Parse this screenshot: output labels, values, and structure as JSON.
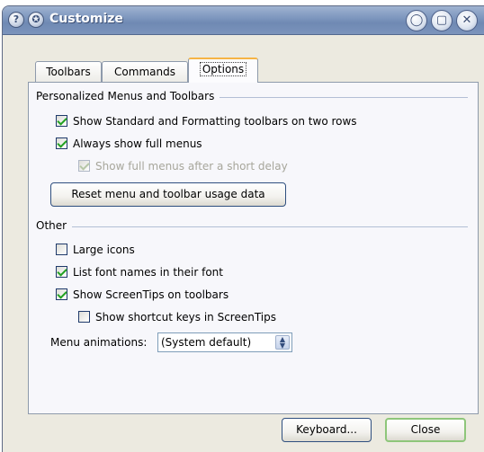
{
  "window": {
    "title": "Customize",
    "help_icon": "?",
    "app_icon": "✪",
    "minimize_symbol": "◯",
    "restore_symbol": "▢",
    "close_symbol": "✕"
  },
  "tabs": [
    {
      "label": "Toolbars",
      "active": false
    },
    {
      "label": "Commands",
      "active": false
    },
    {
      "label": "Options",
      "active": true
    }
  ],
  "personalized": {
    "group_title": "Personalized Menus and Toolbars",
    "two_rows": {
      "label": "Show Standard and Formatting toolbars on two rows",
      "checked": true,
      "enabled": true
    },
    "full_menus": {
      "label": "Always show full menus",
      "checked": true,
      "enabled": true
    },
    "delay": {
      "label": "Show full menus after a short delay",
      "checked": true,
      "enabled": false
    },
    "reset_button": "Reset menu and toolbar usage data"
  },
  "other": {
    "group_title": "Other",
    "large_icons": {
      "label": "Large icons",
      "checked": false
    },
    "font_names": {
      "label": "List font names in their font",
      "checked": true
    },
    "screentips": {
      "label": "Show ScreenTips on toolbars",
      "checked": true
    },
    "shortcut_keys": {
      "label": "Show shortcut keys in ScreenTips",
      "checked": false
    },
    "animations_label": "Menu animations:",
    "animations_value": "(System default)"
  },
  "footer": {
    "keyboard_button": "Keyboard...",
    "close_button": "Close"
  }
}
